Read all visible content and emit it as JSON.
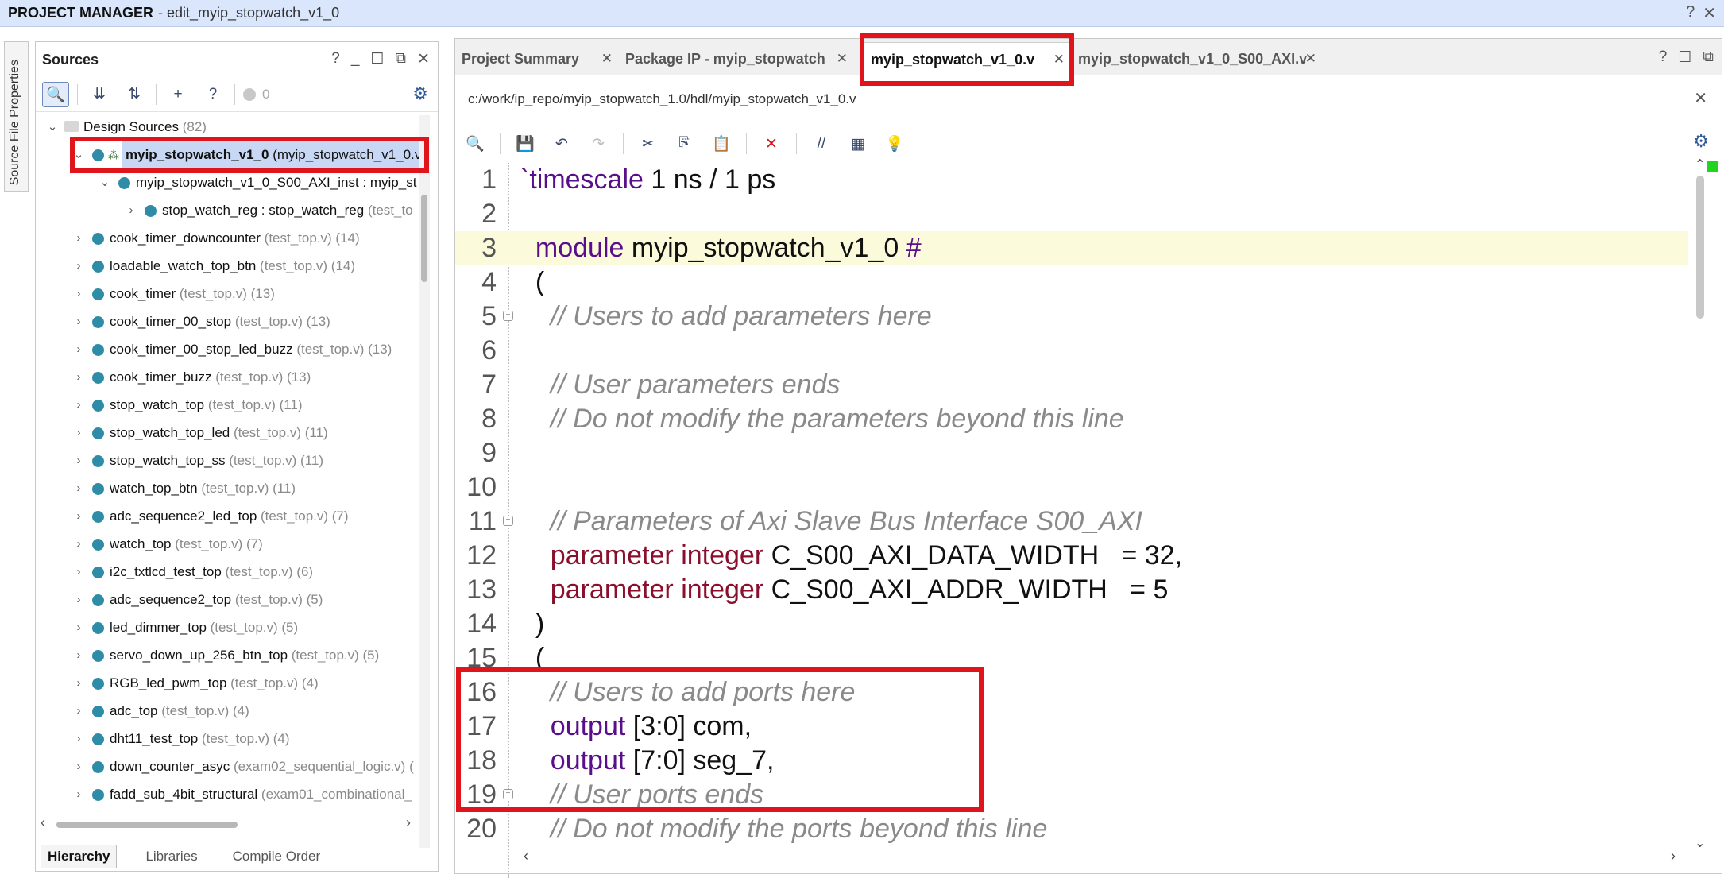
{
  "titlebar": {
    "title": "PROJECT MANAGER",
    "subtitle": "- edit_myip_stopwatch_v1_0",
    "help": "?",
    "close": "✕"
  },
  "sidetab": {
    "label": "Source File Properties"
  },
  "sources": {
    "title": "Sources",
    "header_icons": [
      "?",
      "_",
      "☐",
      "⧉",
      "✕"
    ],
    "toolbar": {
      "search": "🔍",
      "collapse": "⇊",
      "expand": "⇅",
      "add": "+",
      "doc": "?",
      "count": "0",
      "gear": "⚙"
    },
    "tree": [
      {
        "name": "Design Sources",
        "sub": " (82)",
        "level": 0,
        "chev": "⌄",
        "kind": "folder"
      },
      {
        "name": "myip_stopwatch_v1_0",
        "sub": " (myip_stopwatch_v1_0.v",
        "level": 1,
        "chev": "⌄",
        "kind": "top",
        "selected": true
      },
      {
        "name": "myip_stopwatch_v1_0_S00_AXI_inst : myip_st",
        "sub": "",
        "level": 2,
        "chev": "⌄",
        "kind": "bullet"
      },
      {
        "name": "stop_watch_reg : stop_watch_reg",
        "sub": " (test_to",
        "level": 3,
        "chev": "›",
        "kind": "bullet"
      },
      {
        "name": "cook_timer_downcounter",
        "sub": " (test_top.v) (14)",
        "level": 1,
        "chev": "›",
        "kind": "bullet"
      },
      {
        "name": "loadable_watch_top_btn",
        "sub": " (test_top.v) (14)",
        "level": 1,
        "chev": "›",
        "kind": "bullet"
      },
      {
        "name": "cook_timer",
        "sub": " (test_top.v) (13)",
        "level": 1,
        "chev": "›",
        "kind": "bullet"
      },
      {
        "name": "cook_timer_00_stop",
        "sub": " (test_top.v) (13)",
        "level": 1,
        "chev": "›",
        "kind": "bullet"
      },
      {
        "name": "cook_timer_00_stop_led_buzz",
        "sub": " (test_top.v) (13)",
        "level": 1,
        "chev": "›",
        "kind": "bullet"
      },
      {
        "name": "cook_timer_buzz",
        "sub": " (test_top.v) (13)",
        "level": 1,
        "chev": "›",
        "kind": "bullet"
      },
      {
        "name": "stop_watch_top",
        "sub": " (test_top.v) (11)",
        "level": 1,
        "chev": "›",
        "kind": "bullet"
      },
      {
        "name": "stop_watch_top_led",
        "sub": " (test_top.v) (11)",
        "level": 1,
        "chev": "›",
        "kind": "bullet"
      },
      {
        "name": "stop_watch_top_ss",
        "sub": " (test_top.v) (11)",
        "level": 1,
        "chev": "›",
        "kind": "bullet"
      },
      {
        "name": "watch_top_btn",
        "sub": " (test_top.v) (11)",
        "level": 1,
        "chev": "›",
        "kind": "bullet"
      },
      {
        "name": "adc_sequence2_led_top",
        "sub": " (test_top.v) (7)",
        "level": 1,
        "chev": "›",
        "kind": "bullet"
      },
      {
        "name": "watch_top",
        "sub": " (test_top.v) (7)",
        "level": 1,
        "chev": "›",
        "kind": "bullet"
      },
      {
        "name": "i2c_txtlcd_test_top",
        "sub": " (test_top.v) (6)",
        "level": 1,
        "chev": "›",
        "kind": "bullet"
      },
      {
        "name": "adc_sequence2_top",
        "sub": " (test_top.v) (5)",
        "level": 1,
        "chev": "›",
        "kind": "bullet"
      },
      {
        "name": "led_dimmer_top",
        "sub": " (test_top.v) (5)",
        "level": 1,
        "chev": "›",
        "kind": "bullet"
      },
      {
        "name": "servo_down_up_256_btn_top",
        "sub": " (test_top.v) (5)",
        "level": 1,
        "chev": "›",
        "kind": "bullet"
      },
      {
        "name": "RGB_led_pwm_top",
        "sub": " (test_top.v) (4)",
        "level": 1,
        "chev": "›",
        "kind": "bullet"
      },
      {
        "name": "adc_top",
        "sub": " (test_top.v) (4)",
        "level": 1,
        "chev": "›",
        "kind": "bullet"
      },
      {
        "name": "dht11_test_top",
        "sub": " (test_top.v) (4)",
        "level": 1,
        "chev": "›",
        "kind": "bullet"
      },
      {
        "name": "down_counter_asyc",
        "sub": " (exam02_sequential_logic.v) (",
        "level": 1,
        "chev": "›",
        "kind": "bullet"
      },
      {
        "name": "fadd_sub_4bit_structural",
        "sub": " (exam01_combinational_",
        "level": 1,
        "chev": "›",
        "kind": "bullet"
      }
    ],
    "bottom_tabs": [
      "Hierarchy",
      "Libraries",
      "Compile Order"
    ]
  },
  "editor": {
    "tabs": [
      {
        "label": "Project Summary",
        "close": "✕",
        "active": false
      },
      {
        "label": "Package IP - myip_stopwatch",
        "close": "✕",
        "active": false
      },
      {
        "label": "myip_stopwatch_v1_0.v",
        "close": "✕",
        "active": true
      },
      {
        "label": "myip_stopwatch_v1_0_S00_AXI.v",
        "close": "✕",
        "active": false
      }
    ],
    "header_icons": [
      "?",
      "☐",
      "⧉"
    ],
    "path": "c:/work/ip_repo/myip_stopwatch_1.0/hdl/myip_stopwatch_v1_0.v",
    "path_close": "✕",
    "toolbar": [
      "🔍",
      "💾",
      "↶",
      "↷",
      "✂",
      "⎘",
      "📋",
      "✕",
      "//",
      "▦",
      "💡"
    ],
    "gear": "⚙",
    "lines": [
      {
        "n": "1",
        "parts": [
          [
            "ts",
            "`timescale"
          ],
          [
            "",
            " 1 ns / 1 ps"
          ]
        ]
      },
      {
        "n": "2",
        "parts": []
      },
      {
        "n": "3",
        "parts": [
          [
            "kw",
            "  module"
          ],
          [
            "",
            " myip_stopwatch_v1_0 "
          ],
          [
            "kw",
            "#"
          ]
        ],
        "hl": true
      },
      {
        "n": "4",
        "parts": [
          [
            "",
            "  ("
          ]
        ]
      },
      {
        "n": "5",
        "parts": [
          [
            "cm",
            "    // Users to add parameters here"
          ]
        ],
        "fold": true
      },
      {
        "n": "6",
        "parts": []
      },
      {
        "n": "7",
        "parts": [
          [
            "cm",
            "    // User parameters ends"
          ]
        ]
      },
      {
        "n": "8",
        "parts": [
          [
            "cm",
            "    // Do not modify the parameters beyond this line"
          ]
        ]
      },
      {
        "n": "9",
        "parts": []
      },
      {
        "n": "10",
        "parts": []
      },
      {
        "n": "11",
        "parts": [
          [
            "cm",
            "    // Parameters of Axi Slave Bus Interface S00_AXI"
          ]
        ],
        "fold": true
      },
      {
        "n": "12",
        "parts": [
          [
            "kw2",
            "    parameter integer"
          ],
          [
            "",
            " C_S00_AXI_DATA_WIDTH   = 32,"
          ]
        ]
      },
      {
        "n": "13",
        "parts": [
          [
            "kw2",
            "    parameter integer"
          ],
          [
            "",
            " C_S00_AXI_ADDR_WIDTH   = 5"
          ]
        ]
      },
      {
        "n": "14",
        "parts": [
          [
            "",
            "  )"
          ]
        ]
      },
      {
        "n": "15",
        "parts": [
          [
            "",
            "  ("
          ]
        ]
      },
      {
        "n": "16",
        "parts": [
          [
            "cm",
            "    // Users to add ports here"
          ]
        ]
      },
      {
        "n": "17",
        "parts": [
          [
            "kw",
            "    output"
          ],
          [
            "",
            " [3:0] com,"
          ]
        ]
      },
      {
        "n": "18",
        "parts": [
          [
            "kw",
            "    output"
          ],
          [
            "",
            " [7:0] seg_7,"
          ]
        ]
      },
      {
        "n": "19",
        "parts": [
          [
            "cm",
            "    // User ports ends"
          ]
        ],
        "fold": true
      },
      {
        "n": "20",
        "parts": [
          [
            "cm",
            "    // Do not modify the ports beyond this line"
          ]
        ]
      }
    ]
  },
  "colors": {
    "highlight_red": "#e0151b",
    "accent_blue": "#2e5a9a",
    "bullet_teal": "#2f8ca6"
  }
}
